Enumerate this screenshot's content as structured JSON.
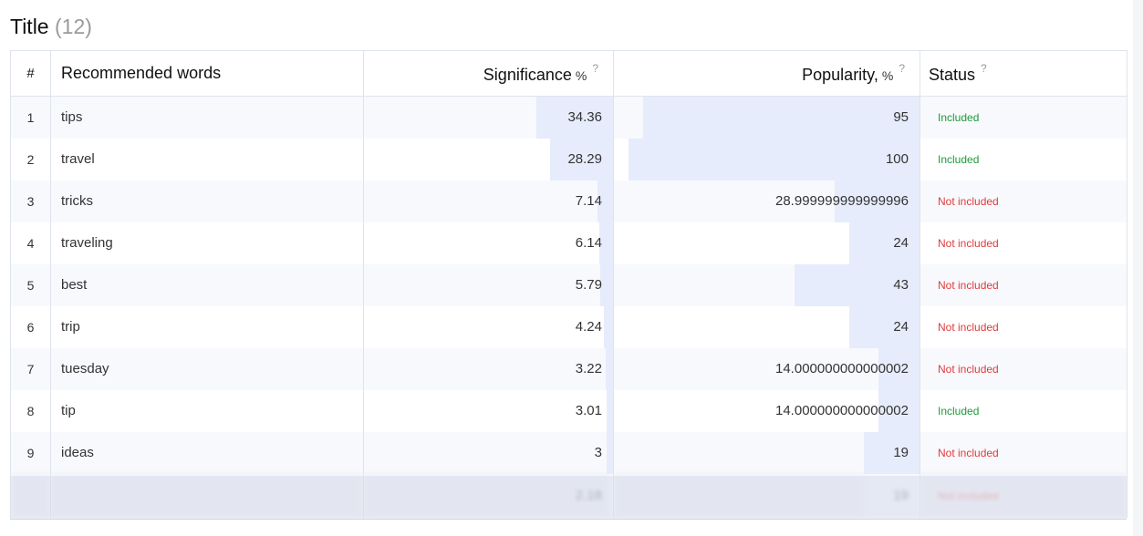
{
  "section": {
    "title": "Title",
    "count": "(12)"
  },
  "table": {
    "headers": {
      "num": "#",
      "word": "Recommended words",
      "significance": "Significance",
      "significance_unit": "%",
      "popularity": "Popularity,",
      "popularity_unit": "%",
      "status": "Status",
      "help": "?"
    },
    "rows": [
      {
        "num": "1",
        "word": "tips",
        "significance": "34.36",
        "sig_level": 0.34,
        "popularity": "95",
        "pop_level": 0.95,
        "status": "Included"
      },
      {
        "num": "2",
        "word": "travel",
        "significance": "28.29",
        "sig_level": 0.28,
        "popularity": "100",
        "pop_level": 1.0,
        "status": "Included"
      },
      {
        "num": "3",
        "word": "tricks",
        "significance": "7.14",
        "sig_level": 0.07,
        "popularity": "28.999999999999996",
        "pop_level": 0.29,
        "status": "Not included"
      },
      {
        "num": "4",
        "word": "traveling",
        "significance": "6.14",
        "sig_level": 0.06,
        "popularity": "24",
        "pop_level": 0.24,
        "status": "Not included"
      },
      {
        "num": "5",
        "word": "best",
        "significance": "5.79",
        "sig_level": 0.058,
        "popularity": "43",
        "pop_level": 0.43,
        "status": "Not included"
      },
      {
        "num": "6",
        "word": "trip",
        "significance": "4.24",
        "sig_level": 0.042,
        "popularity": "24",
        "pop_level": 0.24,
        "status": "Not included"
      },
      {
        "num": "7",
        "word": "tuesday",
        "significance": "3.22",
        "sig_level": 0.032,
        "popularity": "14.000000000000002",
        "pop_level": 0.14,
        "status": "Not included"
      },
      {
        "num": "8",
        "word": "tip",
        "significance": "3.01",
        "sig_level": 0.03,
        "popularity": "14.000000000000002",
        "pop_level": 0.14,
        "status": "Included"
      },
      {
        "num": "9",
        "word": "ideas",
        "significance": "3",
        "sig_level": 0.03,
        "popularity": "19",
        "pop_level": 0.19,
        "status": "Not included"
      },
      {
        "num": "",
        "word": "",
        "significance": "2.18",
        "sig_level": 0.022,
        "popularity": "19",
        "pop_level": 0.19,
        "status": "Not included",
        "faded": true
      }
    ]
  },
  "colors": {
    "bar": "#e6ecfb",
    "included": "#1f9a3a",
    "not_included": "#e03b3b"
  }
}
